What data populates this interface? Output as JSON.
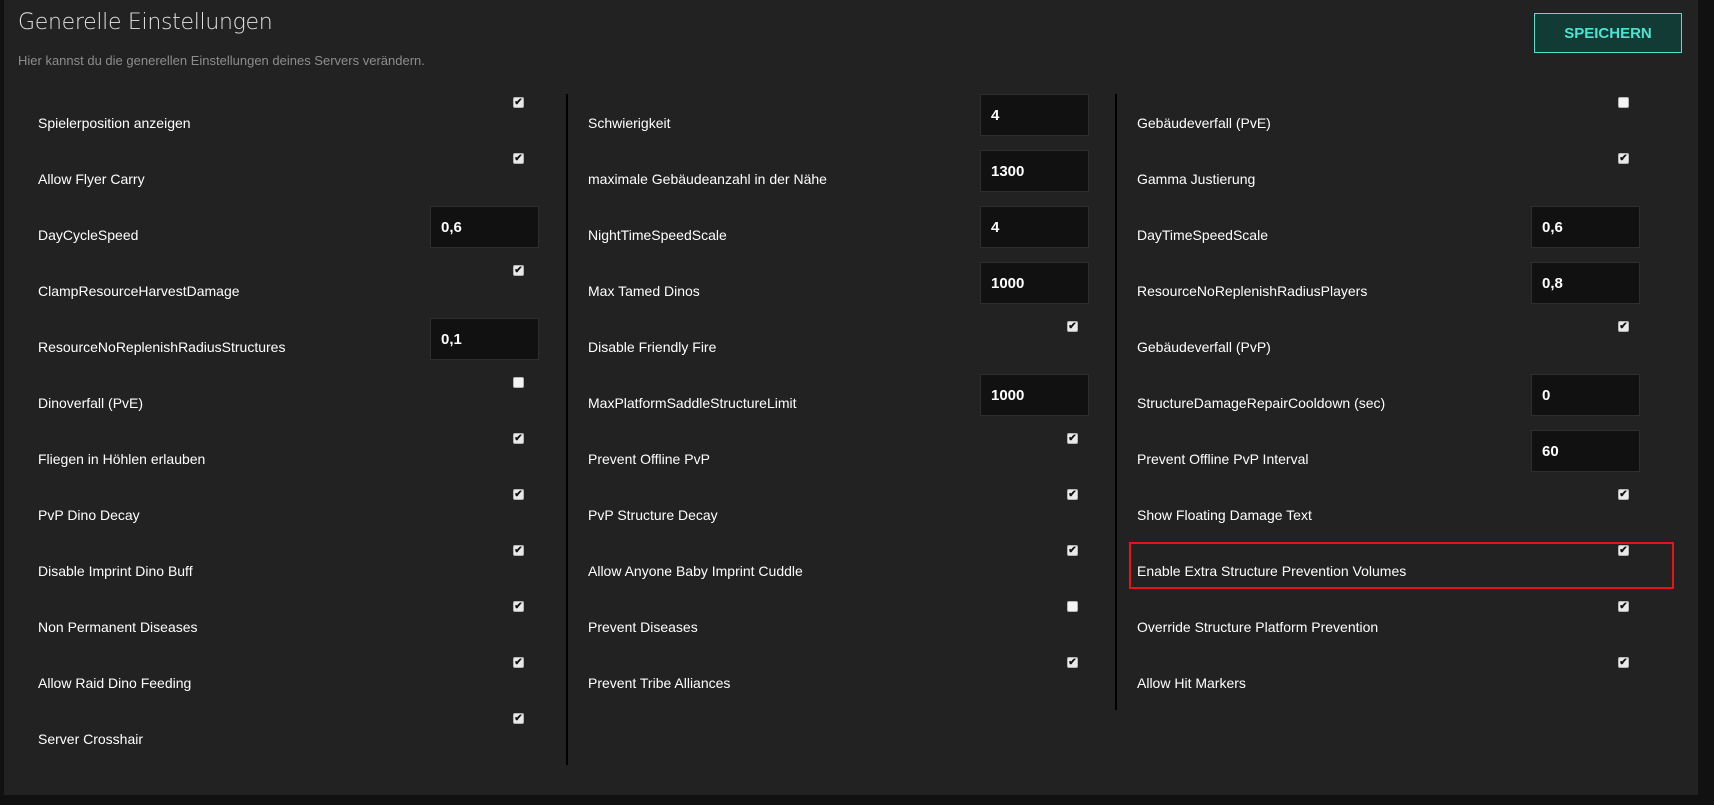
{
  "header": {
    "title": "Generelle Einstellungen",
    "subtitle": "Hier kannst du die generellen Einstellungen deines Servers verändern.",
    "save_label": "SPEICHERN"
  },
  "colors": {
    "accent": "#4fe3cf",
    "panel_bg": "#222222",
    "highlight": "#e8121b"
  },
  "columns": [
    [
      {
        "label": "Spielerposition anzeigen",
        "type": "checkbox",
        "checked": true
      },
      {
        "label": "Allow Flyer Carry",
        "type": "checkbox",
        "checked": true
      },
      {
        "label": "DayCycleSpeed",
        "type": "input",
        "value": "0,6"
      },
      {
        "label": "ClampResourceHarvestDamage",
        "type": "checkbox",
        "checked": true
      },
      {
        "label": "ResourceNoReplenishRadiusStructures",
        "type": "input",
        "value": "0,1"
      },
      {
        "label": "Dinoverfall (PvE)",
        "type": "checkbox",
        "checked": false
      },
      {
        "label": "Fliegen in Höhlen erlauben",
        "type": "checkbox",
        "checked": true
      },
      {
        "label": "PvP Dino Decay",
        "type": "checkbox",
        "checked": true
      },
      {
        "label": "Disable Imprint Dino Buff",
        "type": "checkbox",
        "checked": true
      },
      {
        "label": "Non Permanent Diseases",
        "type": "checkbox",
        "checked": true
      },
      {
        "label": "Allow Raid Dino Feeding",
        "type": "checkbox",
        "checked": true
      },
      {
        "label": "Server Crosshair",
        "type": "checkbox",
        "checked": true
      }
    ],
    [
      {
        "label": "Schwierigkeit",
        "type": "input",
        "value": "4"
      },
      {
        "label": "maximale Gebäudeanzahl in der Nähe",
        "type": "input",
        "value": "1300"
      },
      {
        "label": "NightTimeSpeedScale",
        "type": "input",
        "value": "4"
      },
      {
        "label": "Max Tamed Dinos",
        "type": "input",
        "value": "1000"
      },
      {
        "label": "Disable Friendly Fire",
        "type": "checkbox",
        "checked": true
      },
      {
        "label": "MaxPlatformSaddleStructureLimit",
        "type": "input",
        "value": "1000"
      },
      {
        "label": "Prevent Offline PvP",
        "type": "checkbox",
        "checked": true
      },
      {
        "label": "PvP Structure Decay",
        "type": "checkbox",
        "checked": true
      },
      {
        "label": "Allow Anyone Baby Imprint Cuddle",
        "type": "checkbox",
        "checked": true
      },
      {
        "label": "Prevent Diseases",
        "type": "checkbox",
        "checked": false
      },
      {
        "label": "Prevent Tribe Alliances",
        "type": "checkbox",
        "checked": true
      }
    ],
    [
      {
        "label": "Gebäudeverfall (PvE)",
        "type": "checkbox",
        "checked": false
      },
      {
        "label": "Gamma Justierung",
        "type": "checkbox",
        "checked": true
      },
      {
        "label": "DayTimeSpeedScale",
        "type": "input",
        "value": "0,6"
      },
      {
        "label": "ResourceNoReplenishRadiusPlayers",
        "type": "input",
        "value": "0,8"
      },
      {
        "label": "Gebäudeverfall (PvP)",
        "type": "checkbox",
        "checked": true
      },
      {
        "label": "StructureDamageRepairCooldown (sec)",
        "type": "input",
        "value": "0"
      },
      {
        "label": "Prevent Offline PvP Interval",
        "type": "input",
        "value": "60"
      },
      {
        "label": "Show Floating Damage Text",
        "type": "checkbox",
        "checked": true
      },
      {
        "label": "Enable Extra Structure Prevention Volumes",
        "type": "checkbox",
        "checked": true
      },
      {
        "label": "Override Structure Platform Prevention",
        "type": "checkbox",
        "checked": true
      },
      {
        "label": "Allow Hit Markers",
        "type": "checkbox",
        "checked": true
      }
    ]
  ]
}
